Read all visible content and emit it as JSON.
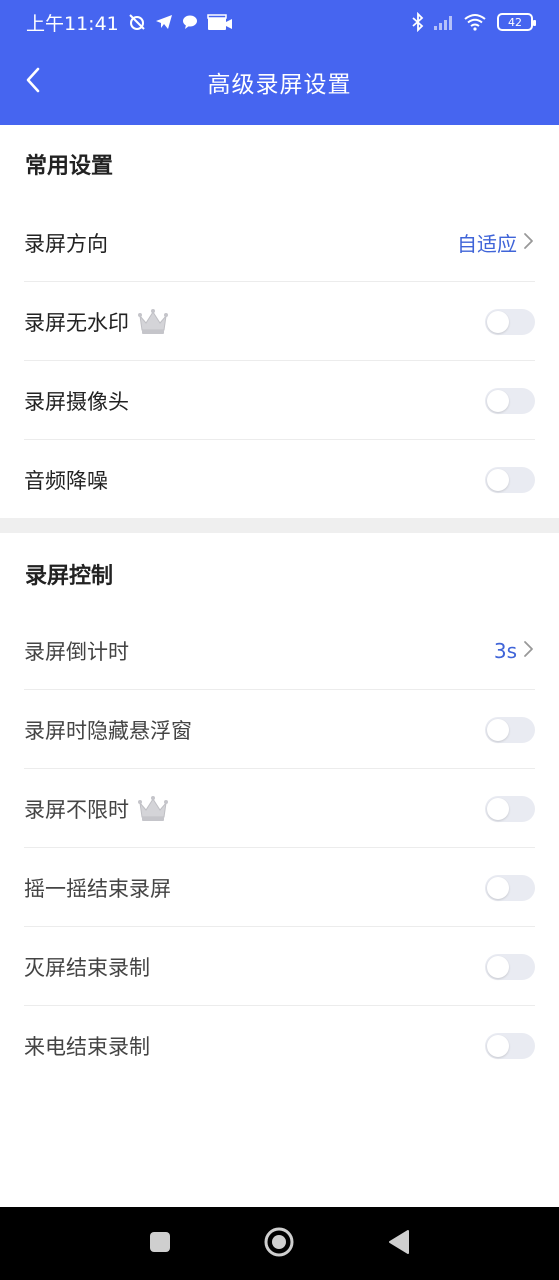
{
  "status_bar": {
    "time": "上午11:41",
    "battery": "42"
  },
  "header": {
    "title": "高级录屏设置"
  },
  "colors": {
    "header_bg": "#4665f0",
    "accent_value": "#3f64d8",
    "toggle_off": "#e9ebf2"
  },
  "sections": [
    {
      "title": "常用设置",
      "rows": [
        {
          "label": "录屏方向",
          "type": "value",
          "value": "自适应"
        },
        {
          "label": "录屏无水印",
          "type": "toggle",
          "on": false,
          "vip": true
        },
        {
          "label": "录屏摄像头",
          "type": "toggle",
          "on": false
        },
        {
          "label": "音频降噪",
          "type": "toggle",
          "on": false
        }
      ]
    },
    {
      "title": "录屏控制",
      "rows": [
        {
          "label": "录屏倒计时",
          "type": "value",
          "value": "3s"
        },
        {
          "label": "录屏时隐藏悬浮窗",
          "type": "toggle",
          "on": false
        },
        {
          "label": "录屏不限时",
          "type": "toggle",
          "on": false,
          "vip": true
        },
        {
          "label": "摇一摇结束录屏",
          "type": "toggle",
          "on": false
        },
        {
          "label": "灭屏结束录制",
          "type": "toggle",
          "on": false
        },
        {
          "label": "来电结束录制",
          "type": "toggle",
          "on": false
        }
      ]
    }
  ],
  "icons": {
    "back": "chevron-left-icon",
    "crown": "crown-icon",
    "chevron": "chevron-right-icon",
    "nav_recent": "square-icon",
    "nav_home": "circle-icon",
    "nav_back": "triangle-back-icon"
  }
}
